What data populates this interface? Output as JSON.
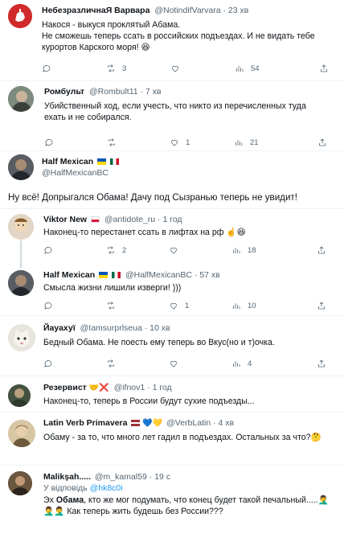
{
  "tweets": [
    {
      "name": "НебезразличнаЯ Варвара",
      "handle": "@NotindifVarvara",
      "time": "23 хв",
      "text": "Накося - выкуся проклятый Абама.\nНе сможешь теперь ссать в российских подъездах. И не видать тебе курортов Карского моря! 😆",
      "replies": "",
      "retweets": "3",
      "likes": "",
      "views": "54"
    },
    {
      "name": "Ромбульт",
      "handle": "@Rombult11",
      "time": "7 хв",
      "text": "Убийственный ход, если учесть, что никто из перечисленных туда ехать и не собирался.",
      "replies": "",
      "retweets": "",
      "likes": "1",
      "views": "21"
    },
    {
      "name": "Half Mexican",
      "handle": "@HalfMexicanBC",
      "text": "Ну всё! Допрыгался Обама! Дачу под Сызранью теперь не увидит!"
    },
    {
      "name": "Viktor New",
      "handle": "@antidote_ru",
      "time": "1 год",
      "text": "Наконец-то перестанет ссать в лифтах на рф ☝️😆",
      "replies": "",
      "retweets": "2",
      "likes": "",
      "views": "18"
    },
    {
      "name": "Half Mexican",
      "handle": "@HalfMexicanBC",
      "time": "57 хв",
      "text": "Смысла жизни лишили изверги! )))",
      "replies": "",
      "retweets": "",
      "likes": "1",
      "views": "10"
    },
    {
      "name": "Йауахуї",
      "handle": "@Iamsurprlseua",
      "time": "10 хв",
      "text": "Бедный Обама. Не поесть ему теперь во Вкус(но и т)очка.",
      "replies": "",
      "retweets": "",
      "likes": "",
      "views": "4"
    },
    {
      "name": "Резервист",
      "handle": "@ifnov1",
      "time": "1 год",
      "text": "Наконец-то, теперь в России будут сухие подъезды..."
    },
    {
      "name": "Latin Verb Primavera",
      "handle": "@VerbLatin",
      "time": "4 хв",
      "text": "Обаму - за то, что много лет гадил в подъездах. Остальных за что?🤔"
    },
    {
      "name": "Malikşah.....",
      "handle": "@m_kamal59",
      "time": "19 с",
      "reply_to_label": "У відповідь",
      "reply_to_handle": "@hk8c0i",
      "text_prefix": "Эх ",
      "text_bold": "Обама",
      "text_rest": ", кто же мог подумать, что конец будет такой печальный.....🤦‍♂️\n🤦‍♂️🤦‍♂️ Как теперь жить будешь без России???"
    }
  ],
  "colors": {
    "accent": "#1d9bf0",
    "muted": "#536471",
    "border": "#eff3f4"
  }
}
